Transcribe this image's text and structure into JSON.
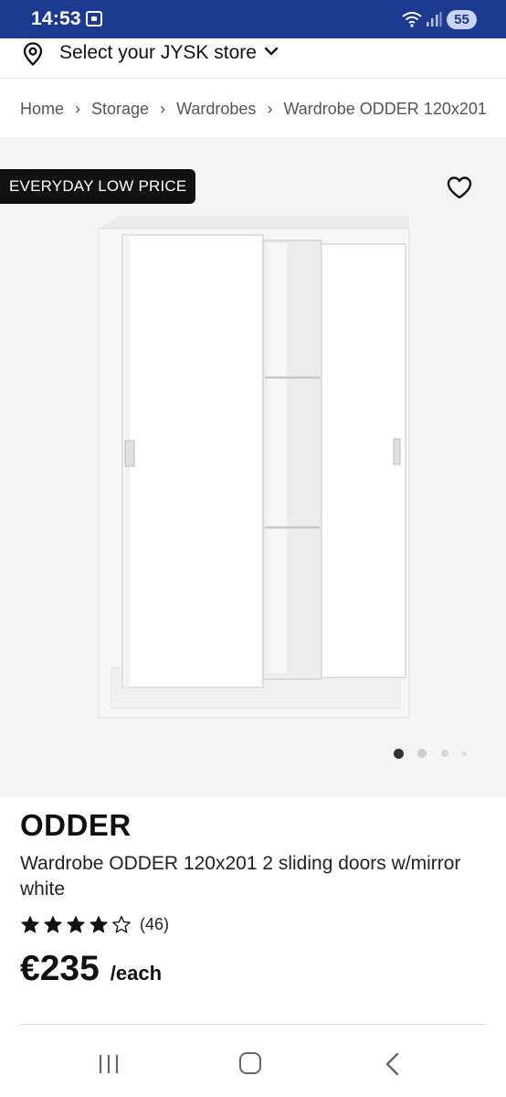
{
  "status_bar": {
    "time": "14:53",
    "battery": "55",
    "background": "#1c3a8f",
    "icons": [
      "screen-cast-icon",
      "wifi-icon",
      "signal-icon",
      "battery-icon"
    ]
  },
  "store_selector": {
    "label": "Select your JYSK store",
    "icon": "location-pin-icon"
  },
  "breadcrumb": [
    "Home",
    "Storage",
    "Wardrobes",
    "Wardrobe ODDER 120x201"
  ],
  "hero": {
    "badge": "EVERYDAY LOW PRICE",
    "favorite_icon": "heart-icon",
    "image_count": 4,
    "active_image": 1
  },
  "product": {
    "brand": "ODDER",
    "description": "Wardrobe ODDER 120x201 2 sliding doors w/mirror white",
    "rating": 4,
    "rating_max": 5,
    "review_count": "(46)",
    "price": "€235",
    "unit": "/each"
  },
  "nav_bar": {
    "icons": [
      "recent-apps-icon",
      "home-icon",
      "back-icon"
    ]
  }
}
